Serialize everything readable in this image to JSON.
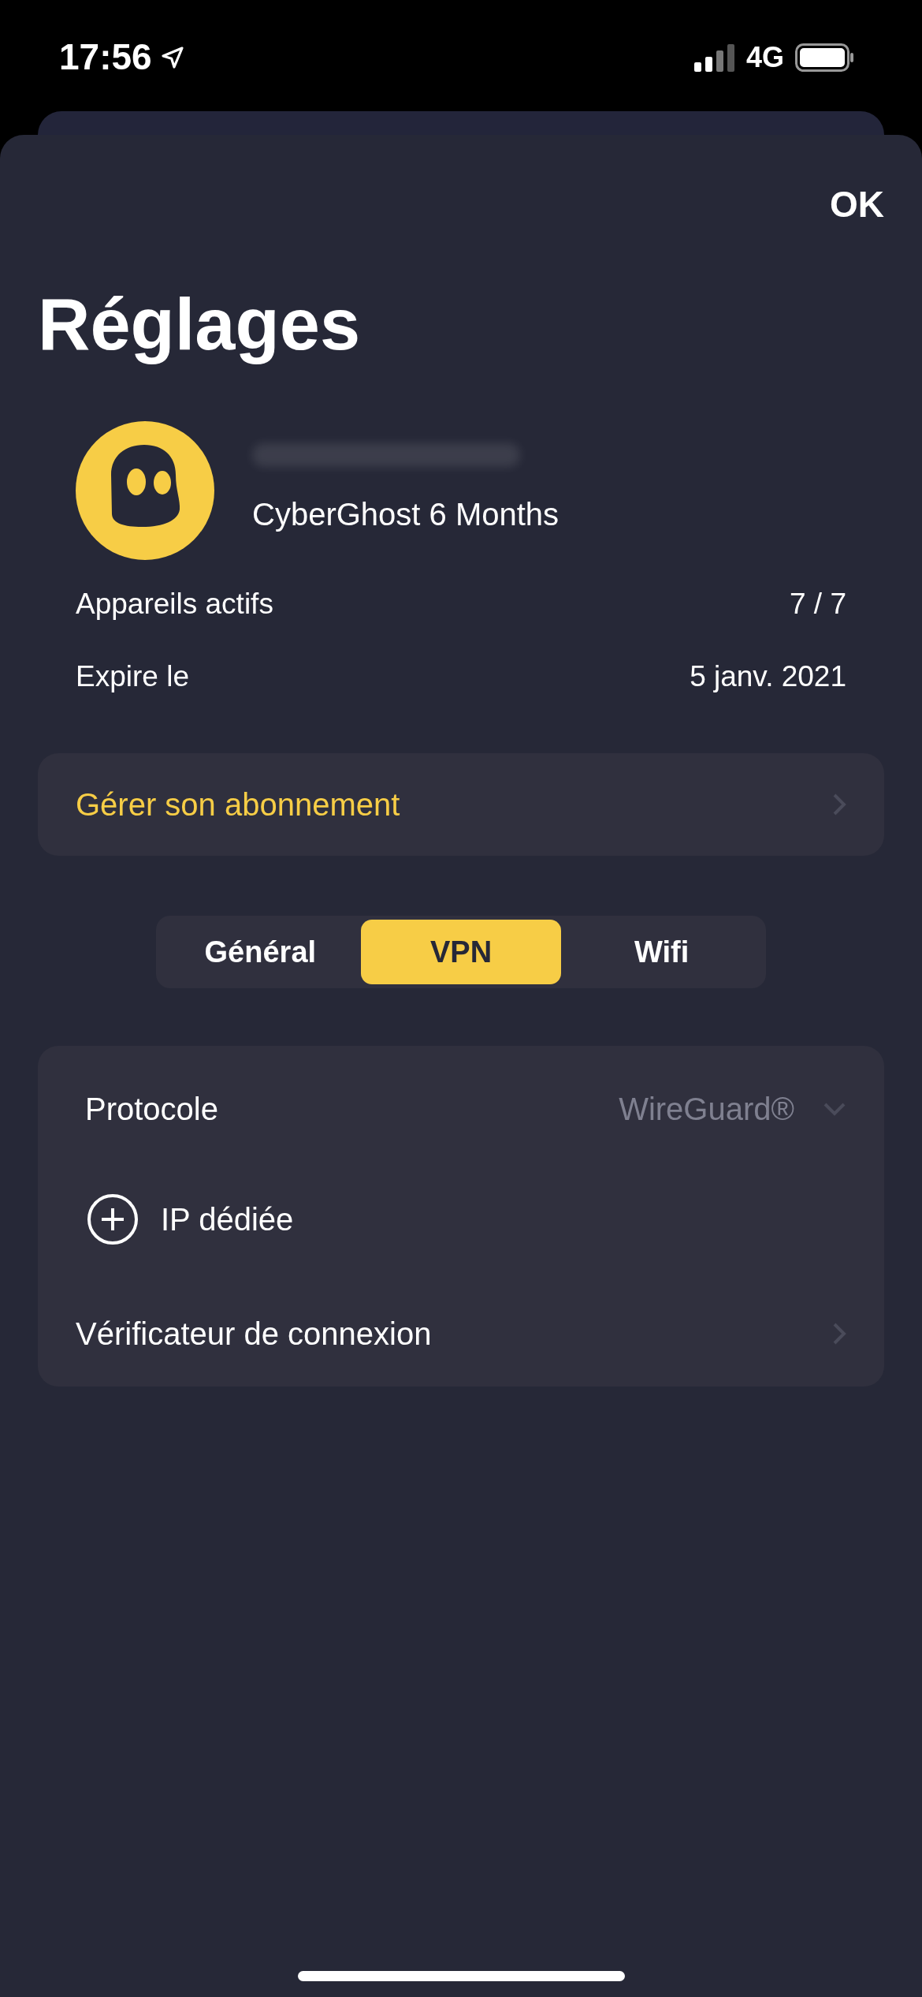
{
  "status_bar": {
    "time": "17:56",
    "network": "4G"
  },
  "header": {
    "done": "OK",
    "title": "Réglages"
  },
  "account": {
    "plan": "CyberGhost 6 Months",
    "details": [
      {
        "label": "Appareils actifs",
        "value": "7 / 7"
      },
      {
        "label": "Expire le",
        "value": "5 janv. 2021"
      }
    ]
  },
  "manage_subscription": {
    "label": "Gérer son abonnement"
  },
  "tabs": [
    {
      "label": "Général",
      "selected": false
    },
    {
      "label": "VPN",
      "selected": true
    },
    {
      "label": "Wifi",
      "selected": false
    }
  ],
  "vpn_settings": [
    {
      "kind": "dropdown",
      "label": "Protocole",
      "value": "WireGuard®"
    },
    {
      "kind": "add",
      "label": "IP dédiée"
    },
    {
      "kind": "link",
      "label": "Vérificateur de connexion"
    }
  ]
}
